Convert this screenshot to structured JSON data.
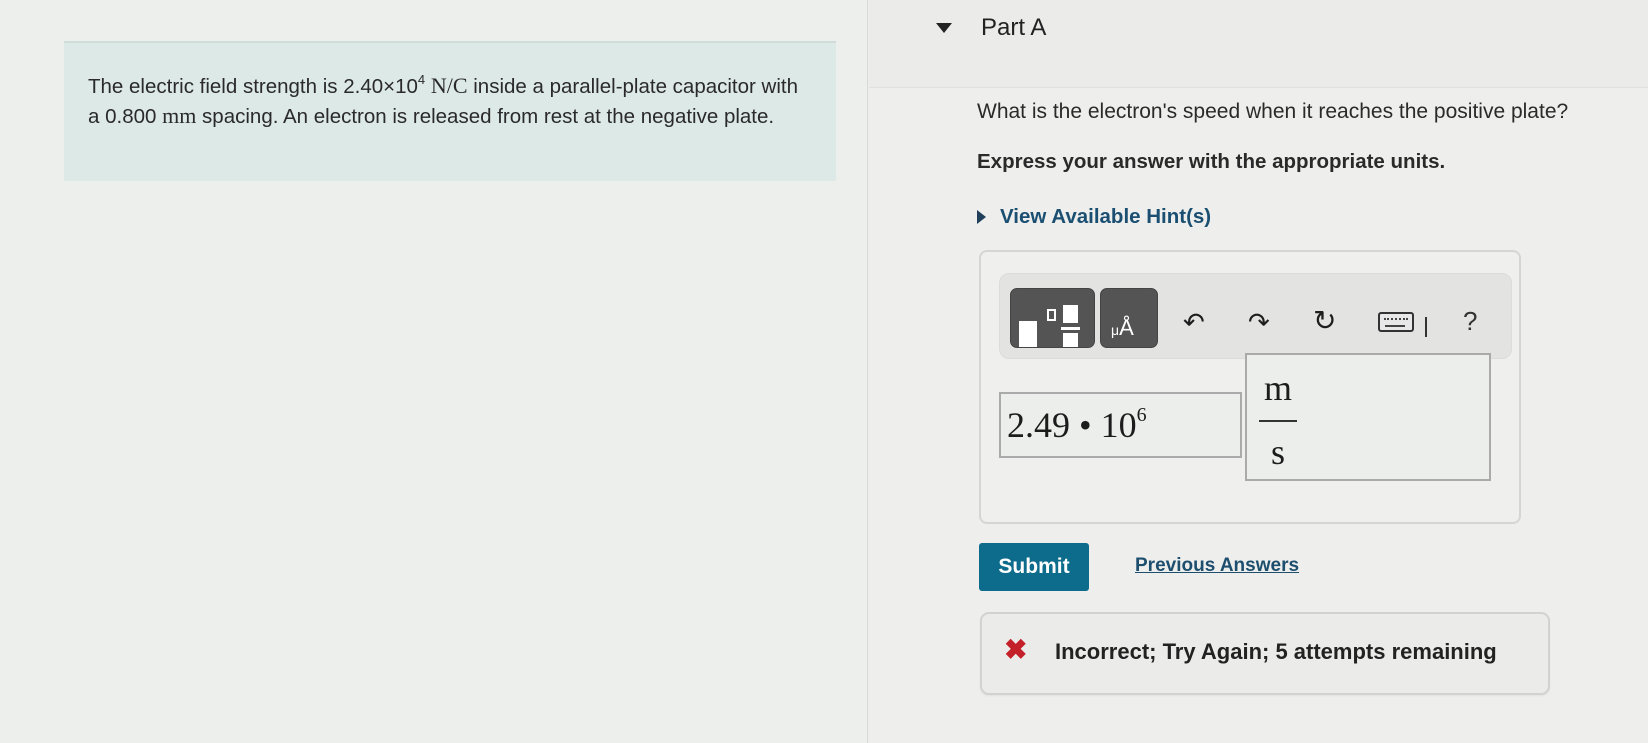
{
  "problem": {
    "text_before_field": "The electric field strength is ",
    "field_value_mantissa": "2.40×10",
    "field_value_exponent": "4",
    "field_unit": "N/C",
    "text_after_field": " inside a parallel-plate capacitor with a ",
    "spacing_value": "0.800",
    "spacing_unit": "mm",
    "text_after_spacing": " spacing. An electron is released from rest at the negative plate."
  },
  "part": {
    "title": "Part A",
    "expanded": true,
    "question": "What is the electron's speed when it reaches the positive plate?",
    "instruction": "Express your answer with the appropriate units.",
    "hints_label": "View Available Hint(s)"
  },
  "toolbar": {
    "buttons": [
      {
        "name": "templates",
        "icon": "templates-icon"
      },
      {
        "name": "units",
        "icon": "units-angstrom-icon",
        "glyph": "Å",
        "prefix": "μ"
      },
      {
        "name": "undo",
        "icon": "undo-icon",
        "glyph": "↶"
      },
      {
        "name": "redo",
        "icon": "redo-icon",
        "glyph": "↷"
      },
      {
        "name": "reset",
        "icon": "reset-icon",
        "glyph": "↻"
      },
      {
        "name": "keyboard",
        "icon": "keyboard-icon"
      },
      {
        "name": "help",
        "icon": "help-icon",
        "glyph": "?"
      }
    ]
  },
  "answer": {
    "value_mantissa": "2.49 • 10",
    "value_exponent": "6",
    "unit_numerator": "m",
    "unit_denominator": "s"
  },
  "actions": {
    "submit_label": "Submit",
    "previous_answers_label": "Previous Answers"
  },
  "feedback": {
    "status": "incorrect",
    "icon": "✖",
    "message": "Incorrect; Try Again; 5 attempts remaining",
    "attempts_remaining": 5
  },
  "colors": {
    "problem_bg": "#dde9e7",
    "submit_bg": "#0d6c8c",
    "link": "#1d4e6e",
    "error": "#c4202a"
  }
}
